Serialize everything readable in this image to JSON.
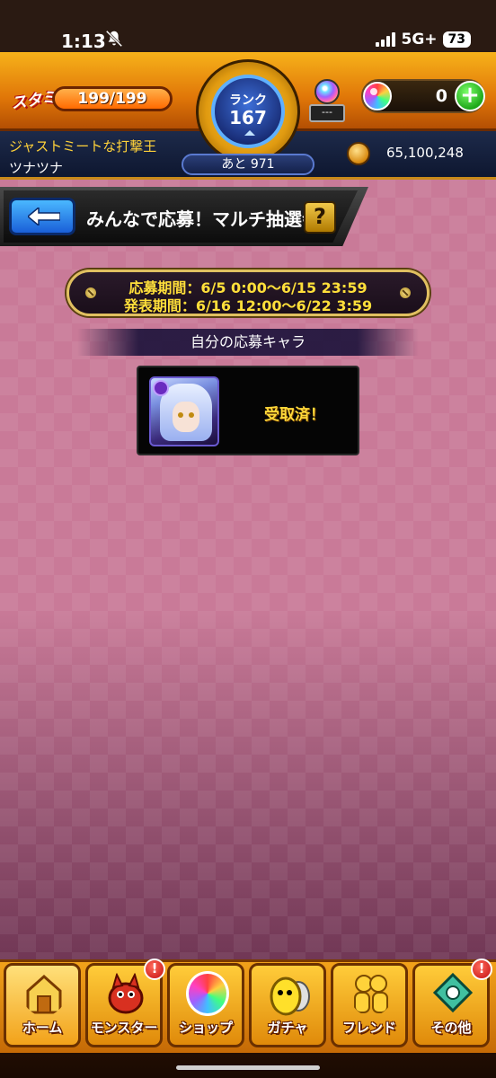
{
  "status_bar": {
    "time": "1:13",
    "network": "5G+",
    "battery": "73"
  },
  "header": {
    "stamina_label": "スタミナ",
    "stamina_value": "199/199",
    "stamina_fraction": 1.0,
    "rank_label": "ランク",
    "rank_value": "167",
    "rank_remaining": "あと 971",
    "hourglass_meter": "---",
    "orb_count": "0",
    "plus_label": "+",
    "player_title": "ジャストミートな打撃王",
    "player_name": "ツナツナ",
    "gold": "65,100,248"
  },
  "banner": {
    "title": "みんなで応募！マルチ抽選会",
    "help_label": "?"
  },
  "period": {
    "entry": "応募期間：6/5 0:00〜6/15 23:59",
    "announce": "発表期間：6/16 12:00〜6/22 3:59"
  },
  "section": {
    "title": "自分の応募キャラ"
  },
  "character_card": {
    "status": "受取済！"
  },
  "bottom_nav": [
    {
      "label": "ホーム",
      "icon": "home-icon",
      "alert": ""
    },
    {
      "label": "モンスター",
      "icon": "monster-icon",
      "alert": "!"
    },
    {
      "label": "ショップ",
      "icon": "shop-icon",
      "alert": ""
    },
    {
      "label": "ガチャ",
      "icon": "gacha-icon",
      "alert": ""
    },
    {
      "label": "フレンド",
      "icon": "friend-icon",
      "alert": ""
    },
    {
      "label": "その他",
      "icon": "other-icon",
      "alert": "!"
    }
  ],
  "colors": {
    "background_pink": "#c97a98",
    "header_orange": "#e07608",
    "period_text": "#ffdf3a",
    "accent_blue": "#1a5fd8"
  }
}
